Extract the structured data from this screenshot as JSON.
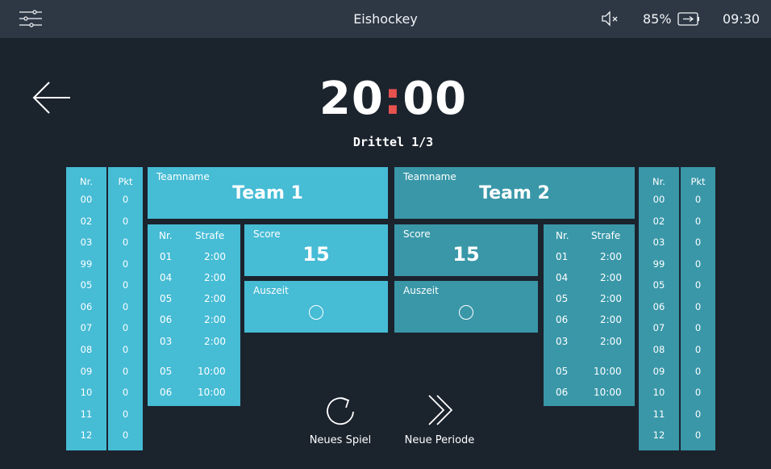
{
  "statusbar": {
    "title": "Eishockey",
    "battery": "85%",
    "time": "09:30",
    "icons": [
      "settings-sliders-icon",
      "volume-muted-icon",
      "battery-charging-icon"
    ]
  },
  "clock": {
    "minutes": "20",
    "separator": ":",
    "seconds": "00"
  },
  "period": "Drittel 1/3",
  "rosters": {
    "hd_nr": "Nr.",
    "hd_pkt": "Pkt",
    "team1": {
      "numbers": [
        "00",
        "02",
        "03",
        "99",
        "05",
        "06",
        "07",
        "08",
        "09",
        "10",
        "11",
        "12"
      ],
      "points": [
        "0",
        "0",
        "0",
        "0",
        "0",
        "0",
        "0",
        "0",
        "0",
        "0",
        "0",
        "0"
      ]
    },
    "team2": {
      "numbers": [
        "00",
        "02",
        "03",
        "99",
        "05",
        "06",
        "07",
        "08",
        "09",
        "10",
        "11",
        "12"
      ],
      "points": [
        "0",
        "0",
        "0",
        "0",
        "0",
        "0",
        "0",
        "0",
        "0",
        "0",
        "0",
        "0"
      ]
    }
  },
  "team1": {
    "name_label": "Teamname",
    "name": "Team 1",
    "score_label": "Score",
    "score": "15",
    "timeout_label": "Auszeit",
    "penalties_header": {
      "nr": "Nr.",
      "strafe": "Strafe"
    },
    "penalties": [
      {
        "nr": "01",
        "time": "2:00"
      },
      {
        "nr": "04",
        "time": "2:00"
      },
      {
        "nr": "05",
        "time": "2:00"
      },
      {
        "nr": "06",
        "time": "2:00"
      },
      {
        "nr": "03",
        "time": "2:00"
      },
      {
        "nr": "05",
        "time": "10:00"
      },
      {
        "nr": "06",
        "time": "10:00"
      }
    ]
  },
  "team2": {
    "name_label": "Teamname",
    "name": "Team 2",
    "score_label": "Score",
    "score": "15",
    "timeout_label": "Auszeit",
    "penalties_header": {
      "nr": "Nr.",
      "strafe": "Strafe"
    },
    "penalties": [
      {
        "nr": "01",
        "time": "2:00"
      },
      {
        "nr": "04",
        "time": "2:00"
      },
      {
        "nr": "05",
        "time": "2:00"
      },
      {
        "nr": "06",
        "time": "2:00"
      },
      {
        "nr": "03",
        "time": "2:00"
      },
      {
        "nr": "05",
        "time": "10:00"
      },
      {
        "nr": "06",
        "time": "10:00"
      }
    ]
  },
  "actions": {
    "new_game": "Neues Spiel",
    "new_period": "Neue Periode"
  },
  "colors": {
    "bg": "#1b232d",
    "statusbar": "#2e3845",
    "team1": "#46bcd5",
    "team2": "#3997a8",
    "clock_colon": "#e8524f"
  }
}
